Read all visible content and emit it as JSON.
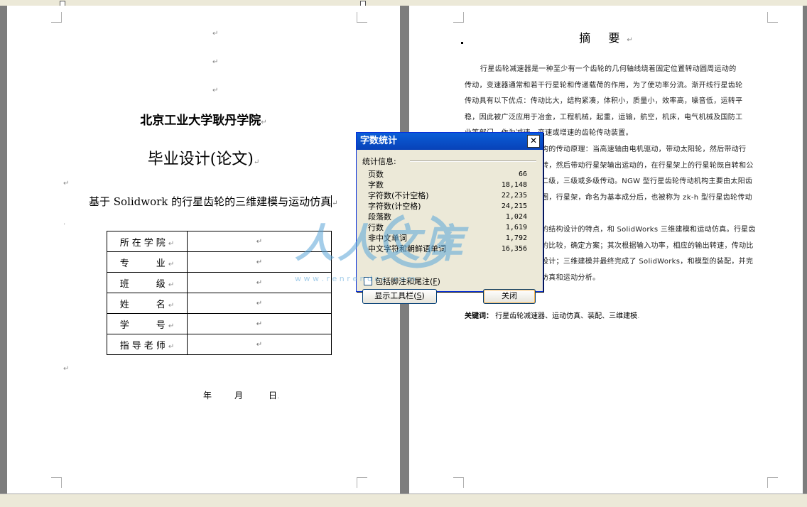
{
  "left_page": {
    "school": "北京工业大学耿丹学院",
    "thesis_type": "毕业设计(论文)",
    "topic": "基于 Solidwork 的行星齿轮的三维建模与运动仿真",
    "info_rows": [
      {
        "label": "所在学院"
      },
      {
        "label": "专　　业"
      },
      {
        "label": "班　　级"
      },
      {
        "label": "姓　　名"
      },
      {
        "label": "学　　号"
      },
      {
        "label": "指导老师"
      }
    ],
    "date": {
      "year": "年",
      "month": "月",
      "day": "日"
    }
  },
  "right_page": {
    "abstract_title": "摘 要",
    "paragraph1_lines": [
      "行星齿轮减速器是一种至少有一个齿轮的几何轴线绕着固定位置转动圆周运动的",
      "传动，变速器通常和若干行星轮和传递载荷的作用，为了使功率分流。渐开线行星齿轮",
      "传动具有以下优点：传动比大，结构紧凑，体积小，质量小，效率高，噪音低，运转平",
      "稳，因此被广泛应用于冶金，工程机械，起重，运输，航空，机床，电气机械及国防工",
      "业等部门，作为减速，变速或增速的齿轮传动装置。"
    ],
    "paragraph2_lines": [
      "构的传动原理：当高速轴由电机驱动，带动太阳轮，然后带动行",
      "转，然后带动行星架输出运动的，在行星架上的行星轮既自转和公",
      "二级，三级或多级传动。NGW 型行星齿轮传动机构主要由太阳齿",
      "圈，行星架，命名为基本成分后，也被称为 zk-h 型行星齿轮传动"
    ],
    "paragraph3_lines": [
      "的结构设计的特点，和 SolidWorks 三维建模和运动仿真。行星齿",
      "的比较，确定方案；其次根据输入功率，相应的输出转速，传动比",
      "设计；三维建模并最终完成了 SolidWorks，和模型的装配，并完",
      "仿真和运动分析。"
    ],
    "keywords_label": "关键词：",
    "keywords": "行星齿轮减速器、运动仿真、装配、三维建模"
  },
  "dialog": {
    "title": "字数统计",
    "group_label": "统计信息:",
    "stats": [
      {
        "label": "页数",
        "value": "66"
      },
      {
        "label": "字数",
        "value": "18,148"
      },
      {
        "label": "字符数(不计空格)",
        "value": "22,235"
      },
      {
        "label": "字符数(计空格)",
        "value": "24,215"
      },
      {
        "label": "段落数",
        "value": "1,024"
      },
      {
        "label": "行数",
        "value": "1,619"
      },
      {
        "label": "非中文单词",
        "value": "1,792"
      },
      {
        "label": "中文字符和朝鲜语单词",
        "value": "16,356"
      }
    ],
    "checkbox_label": "包括脚注和尾注",
    "checkbox_key": "F",
    "show_toolbar_label": "显示工具栏",
    "show_toolbar_key": "S",
    "close_label": "关闭"
  },
  "watermark": {
    "text": "人人文库",
    "url_text": "w w w . r e n r e n d o c . c o m"
  },
  "colors": {
    "titlebar": "#0a5ed8",
    "dialog_bg": "#ece9d8",
    "gutter": "#7d7d7d",
    "watermark": "#5aa6d8"
  }
}
